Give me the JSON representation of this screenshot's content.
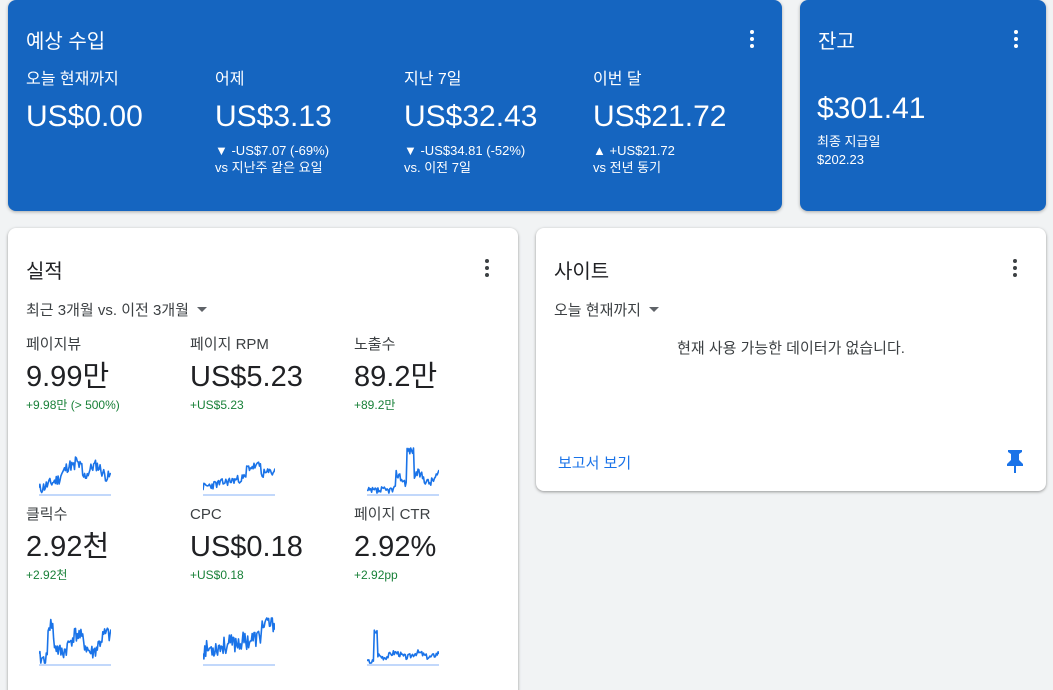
{
  "earnings": {
    "title": "예상 수입",
    "stats": [
      {
        "label": "오늘 현재까지",
        "value": "US$0.00",
        "change": "",
        "compare": ""
      },
      {
        "label": "어제",
        "value": "US$3.13",
        "change": "▼ -US$7.07 (-69%)",
        "compare": "vs 지난주 같은 요일"
      },
      {
        "label": "지난 7일",
        "value": "US$32.43",
        "change": "▼ -US$34.81 (-52%)",
        "compare": "vs. 이전 7일"
      },
      {
        "label": "이번 달",
        "value": "US$21.72",
        "change": "▲ +US$21.72",
        "compare": "vs 전년 동기"
      }
    ]
  },
  "balance": {
    "title": "잔고",
    "value": "$301.41",
    "last_payment_label": "최종 지급일",
    "last_payment_amount": "$202.23"
  },
  "performance": {
    "title": "실적",
    "range": "최근 3개월 vs. 이전 3개월",
    "metrics": [
      {
        "label": "페이지뷰",
        "value": "9.99만",
        "change": "+9.98만 (> 500%)",
        "icon": "pageviews-sparkline"
      },
      {
        "label": "페이지 RPM",
        "value": "US$5.23",
        "change": "+US$5.23",
        "icon": "rpm-sparkline"
      },
      {
        "label": "노출수",
        "value": "89.2만",
        "change": "+89.2만",
        "icon": "impressions-sparkline"
      },
      {
        "label": "클릭수",
        "value": "2.92천",
        "change": "+2.92천",
        "icon": "clicks-sparkline"
      },
      {
        "label": "CPC",
        "value": "US$0.18",
        "change": "+US$0.18",
        "icon": "cpc-sparkline"
      },
      {
        "label": "페이지 CTR",
        "value": "2.92%",
        "change": "+2.92pp",
        "icon": "ctr-sparkline"
      }
    ]
  },
  "sites": {
    "title": "사이트",
    "range": "오늘 현재까지",
    "no_data": "현재 사용 가능한 데이터가 없습니다.",
    "report_link": "보고서 보기"
  },
  "colors": {
    "header_blue": "#1565c0",
    "positive_green": "#188038",
    "link_blue": "#1a73e8",
    "spark_line": "#1a73e8",
    "spark_base": "#aecbfa"
  }
}
